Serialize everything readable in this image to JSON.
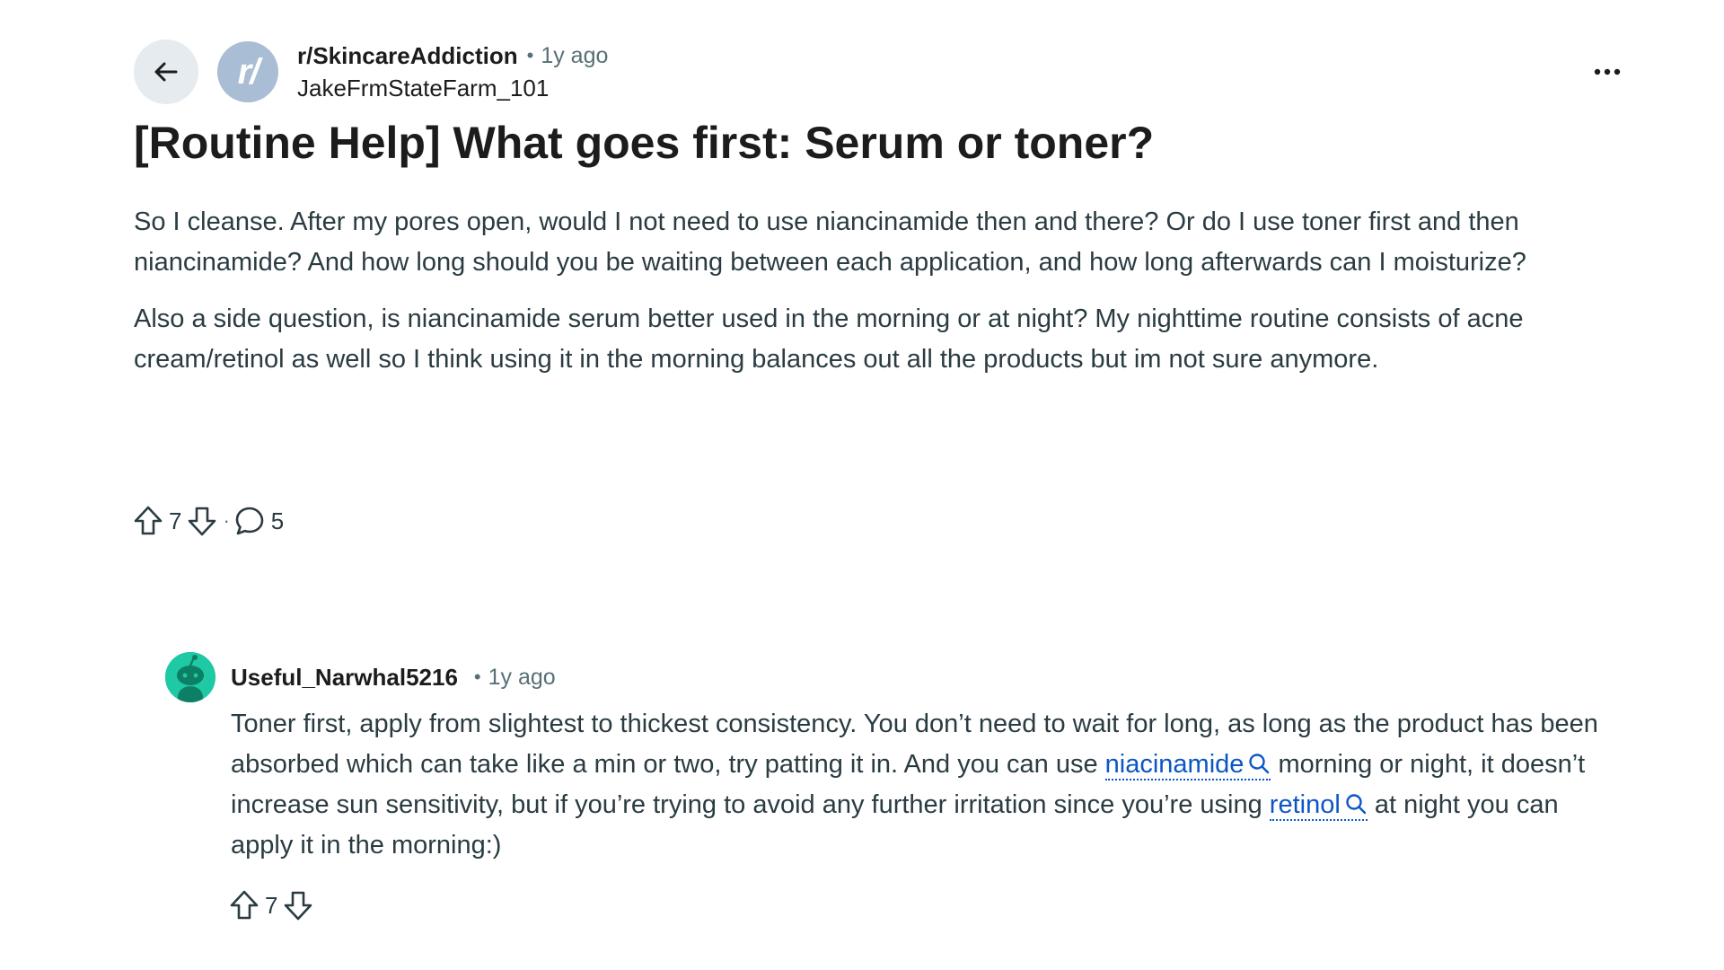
{
  "post": {
    "subreddit": "r/SkincareAddiction",
    "time": "1y ago",
    "author": "JakeFrmStateFarm_101",
    "subreddit_icon_text": "r/",
    "title": "[Routine Help] What goes first: Serum or toner?",
    "body": [
      "So I cleanse. After my pores open, would I not need to use niancinamide then and there? Or do I use toner first and then niancinamide? And how long should you be waiting between each application, and how long afterwards can I moisturize?",
      "Also a side question, is niancinamide serum better used in the morning or at night? My nighttime routine consists of acne cream/retinol as well so I think using it in the morning balances out all the products but im not sure anymore."
    ],
    "votes": "7",
    "comments": "5"
  },
  "comment": {
    "author": "Useful_Narwhal5216",
    "time": "1y ago",
    "text": {
      "part1": "Toner first, apply from slightest to thickest consistency. You don’t need to wait for long, as long as the product has been absorbed which can take like a min or two, try patting it in. And you can use ",
      "keyword1": "niacinamide",
      "part2": " morning or night, it doesn’t increase sun sensitivity, but if you’re trying to avoid any further irritation since you’re using ",
      "keyword2": "retinol",
      "part3": " at night you can apply it in the morning:)"
    },
    "votes": "7"
  },
  "separator_dot": "•",
  "actions_dot": "·",
  "icons": {
    "back": "arrow-left-icon",
    "more": "more-horizontal-icon",
    "upvote": "upvote-arrow-icon",
    "downvote": "downvote-arrow-icon",
    "comment": "speech-bubble-icon",
    "search": "search-icon"
  },
  "colors": {
    "link": "#0b56c6",
    "meta": "#576f76",
    "text": "#2a3c42",
    "title": "#1c1c1c",
    "back_button_bg": "#e5ebee",
    "sub_avatar_bg": "#a9bdd4",
    "comment_avatar_bg": "#1ec9a4"
  }
}
